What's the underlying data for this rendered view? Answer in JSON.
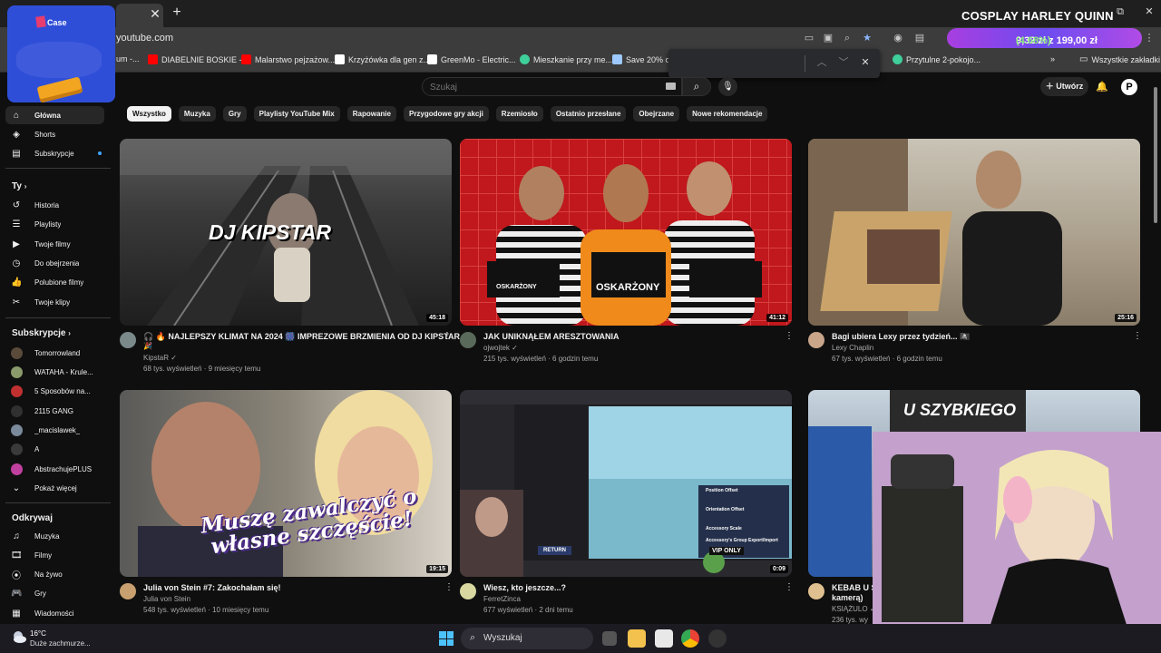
{
  "browser": {
    "url": "youtube.com",
    "stream_title": "COSPLAY HARLEY QUINN",
    "bookmarks": [
      {
        "label": "um -...",
        "color": "#7a7a7a"
      },
      {
        "label": "DIABELNIE BOSKIE -...",
        "color": "#ff0000"
      },
      {
        "label": "Malarstwo pejzażow...",
        "color": "#ff0000"
      },
      {
        "label": "Krzyżówka dla gen z...",
        "color": "#ffffff"
      },
      {
        "label": "GreenMo - Electric...",
        "color": "#ffffff"
      },
      {
        "label": "Mieszkanie przy me...",
        "color": "#3ecf9a"
      },
      {
        "label": "Save 20% on",
        "color": "#9ec9ff"
      },
      {
        "label": "Przytulne 2-pokojo...",
        "color": "#3ecf9a"
      }
    ],
    "all_bookmarks_label": "Wszystkie zakładki"
  },
  "overlay": {
    "logo_text": "Case",
    "donation_text": "9,32 zł z 199,00 zł",
    "donation_pct": "(4.68%)"
  },
  "youtube": {
    "search_placeholder": "Szukaj",
    "create_label": "Utwórz",
    "avatar_letter": "P",
    "chips": [
      "Wszystko",
      "Muzyka",
      "Gry",
      "Playlisty YouTube Mix",
      "Rapowanie",
      "Przygodowe gry akcji",
      "Rzemiosło",
      "Ostatnio przesłane",
      "Obejrzane",
      "Nowe rekomendacje"
    ],
    "sidebar": {
      "main": [
        {
          "label": "Główna",
          "icon": "home-icon"
        },
        {
          "label": "Shorts",
          "icon": "shorts-icon"
        },
        {
          "label": "Subskrypcje",
          "icon": "subscriptions-icon"
        }
      ],
      "you_heading": "Ty",
      "you": [
        {
          "label": "Historia",
          "icon": "history-icon"
        },
        {
          "label": "Playlisty",
          "icon": "playlist-icon"
        },
        {
          "label": "Twoje filmy",
          "icon": "your-videos-icon"
        },
        {
          "label": "Do obejrzenia",
          "icon": "watch-later-icon"
        },
        {
          "label": "Polubione filmy",
          "icon": "like-icon"
        },
        {
          "label": "Twoje klipy",
          "icon": "clips-icon"
        }
      ],
      "subs_heading": "Subskrypcje",
      "subs": [
        {
          "label": "Tomorrowland",
          "color": "#5a4a3a"
        },
        {
          "label": "WATAHA - Krule...",
          "color": "#8a9a6a"
        },
        {
          "label": "5 Sposobów na...",
          "color": "#c03030"
        },
        {
          "label": "2115 GANG",
          "color": "#303030"
        },
        {
          "label": "_macislawek_",
          "color": "#7a8a9a"
        },
        {
          "label": "A",
          "color": "#3a3a3a"
        },
        {
          "label": "AbstrachujePLUS",
          "color": "#c040a0"
        }
      ],
      "show_more": "Pokaż więcej",
      "explore_heading": "Odkrywaj",
      "explore": [
        {
          "label": "Muzyka",
          "icon": "music-icon"
        },
        {
          "label": "Filmy",
          "icon": "movies-icon"
        },
        {
          "label": "Na żywo",
          "icon": "live-icon"
        },
        {
          "label": "Gry",
          "icon": "gaming-icon"
        },
        {
          "label": "Wiadomości",
          "icon": "news-icon"
        }
      ]
    },
    "videos": [
      {
        "title": "🎧 🔥 NAJLEPSZY KLIMAT NA 2024 🎆 IMPREZOWE BRZMIENIA OD DJ KIPSTAR 🌟",
        "title2": "🎉",
        "channel": "KipstaR",
        "verified": true,
        "stats": "68 tys. wyświetleń · 9 miesięcy temu",
        "duration": "45:18",
        "thumb_text": "DJ KIPSTAR"
      },
      {
        "title": "JAK UNIKNĄŁEM ARESZTOWANIA",
        "channel": "ojwojtek",
        "verified": true,
        "stats": "215 tys. wyświetleń · 6 godzin temu",
        "duration": "41:12",
        "thumb_text": "OSKARŻONY",
        "thumb_text_small": "OSKARŻONY"
      },
      {
        "title": "Bagi ubiera Lexy przez tydzień... 🏴‍☠️",
        "channel": "Lexy Chaplin",
        "verified": false,
        "stats": "67 tys. wyświetleń · 6 godzin temu",
        "duration": "25:16"
      },
      {
        "title": "Julia von Stein #7: Zakochałam się!",
        "channel": "Julia von Stein",
        "verified": false,
        "stats": "548 tys. wyświetleń · 10 miesięcy temu",
        "duration": "19:15",
        "thumb_text": "Muszę zawalczyć o własne szczęście!"
      },
      {
        "title": "Wiesz, kto jeszcze...?",
        "channel": "FerretZinca",
        "verified": false,
        "stats": "677 wyświetleń · 2 dni temu",
        "duration": "0:09",
        "thumb_labels": [
          "Position Offset",
          "Orientation Offset",
          "Accessory Scale",
          "Accessory's Group Export/Import",
          "VIP ONLY",
          "RETURN"
        ]
      },
      {
        "title": "KEBAB U SZ",
        "title2": "kamerą)",
        "channel": "KSIĄŻULO",
        "verified": true,
        "stats": "236 tys. wy",
        "thumb_text": "U SZYBKIEGO"
      }
    ]
  },
  "taskbar": {
    "temperature": "16°C",
    "weather": "Duże zachmurze...",
    "search": "Wyszukaj"
  }
}
